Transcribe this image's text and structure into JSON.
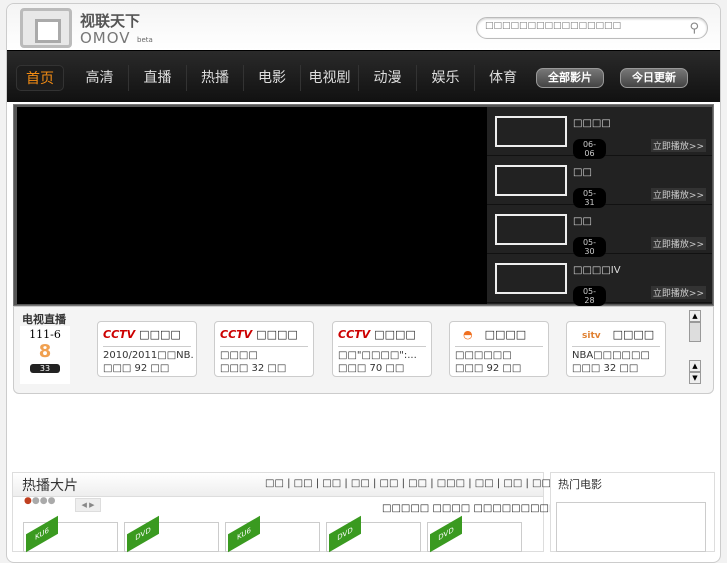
{
  "logo": {
    "cn": "视联天下",
    "en": "OMOV",
    "beta": "beta"
  },
  "search": {
    "placeholder": "□□□□□□□□□□□□□□□□"
  },
  "nav": {
    "items": [
      "首页",
      "高清",
      "直播",
      "热播",
      "电影",
      "电视剧",
      "动漫",
      "娱乐",
      "体育"
    ],
    "buttons": [
      "全部影片",
      "今日更新"
    ],
    "accent": "#f28c14"
  },
  "featured": [
    {
      "title": "□□□□",
      "date": "06-06",
      "play": "立即播放>>"
    },
    {
      "title": "□□",
      "date": "05-31",
      "play": "立即播放>>"
    },
    {
      "title": "□□",
      "date": "05-30",
      "play": "立即播放>>"
    },
    {
      "title": "□□□□IV",
      "date": "05-28",
      "play": "立即播放>>"
    }
  ],
  "live": {
    "label": "电视直播",
    "date_top": "111-6",
    "date_day": "8",
    "clock": "33",
    "channels": [
      {
        "logo": "CCTV",
        "name": "□□□□",
        "program": "2010/2011□□NB...",
        "count": "□□□ 92 □□"
      },
      {
        "logo": "CCTV",
        "name": "□□□□",
        "program": "□□□□",
        "count": "□□□ 32 □□"
      },
      {
        "logo": "CCTV",
        "name": "□□□□",
        "program": "□□\"□□□□\":...",
        "count": "□□□ 70 □□"
      },
      {
        "logo": "◓",
        "name": "□□□□",
        "program": "□□□□□□",
        "count": "□□□ 92 □□"
      },
      {
        "logo": "sitv",
        "name": "□□□□",
        "program": "NBA□□□□□□",
        "count": "□□□ 32 □□"
      }
    ]
  },
  "hot": {
    "title": "热播大片",
    "categories": "□□ | □□ | □□ | □□ | □□ | □□ | □□□ | □□ | □□ | □□ | □□ | □□",
    "more": "□□>>",
    "news": "□□□□□ □□□□ □□□□□□□□□ □□□□□□□□…",
    "tags": [
      "KU6",
      "DVD",
      "KU6",
      "DVD",
      "DVD"
    ]
  },
  "side": {
    "title": "热门电影"
  }
}
